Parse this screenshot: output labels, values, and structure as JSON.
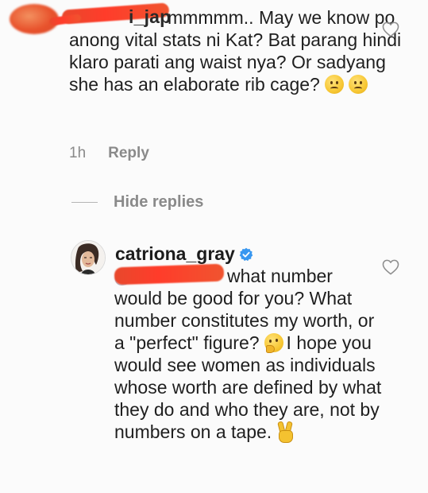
{
  "comment_1": {
    "username_visible": "i_jap",
    "text": "mmmmm.. May we know po anong vital stats ni Kat? Bat parang hindi klaro parati ang waist nya? Or sadyang she has an elaborate rib cage?",
    "emojis": [
      "frowning-face-emoji",
      "frowning-face-emoji"
    ],
    "time": "1h",
    "reply_label": "Reply",
    "like_icon": "heart-outline-icon"
  },
  "thread": {
    "hide_replies_label": "Hide replies"
  },
  "comment_2": {
    "username": "catriona_gray",
    "verified": true,
    "verified_color": "#3897f0",
    "text_line_1": "what number would be good for you? What number constitutes my worth, or a \"perfect\" figure?",
    "text_line_2": "I hope you would see women as individuals whose worth are defined by what they do and who they are, not by numbers on a tape.",
    "emojis": [
      "thinking-face-emoji",
      "victory-hand-emoji"
    ],
    "like_icon": "heart-outline-icon"
  },
  "colors": {
    "redaction": "#ef4a2e",
    "meta_gray": "#8a8a8a",
    "text": "#1f1f1f"
  }
}
